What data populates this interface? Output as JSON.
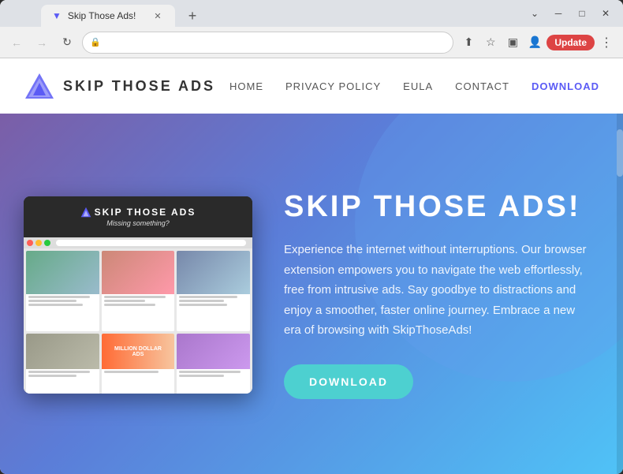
{
  "browser": {
    "tab_title": "Skip Those Ads!",
    "tab_favicon": "▼",
    "new_tab_icon": "+",
    "window_controls": {
      "chevron_down": "⌄",
      "minimize": "─",
      "maximize": "□",
      "close": "✕"
    },
    "nav": {
      "back_icon": "←",
      "forward_icon": "→",
      "refresh_icon": "↻",
      "lock_icon": "🔒",
      "address": "",
      "share_icon": "⬆",
      "star_icon": "☆",
      "tab_icon": "▣",
      "profile_icon": "👤",
      "update_label": "Update",
      "menu_icon": "⋮"
    }
  },
  "site": {
    "logo_text": "SKIP  THOSE  ADS",
    "nav_links": [
      {
        "label": "Home",
        "active": false
      },
      {
        "label": "Privacy Policy",
        "active": false
      },
      {
        "label": "EULA",
        "active": false
      },
      {
        "label": "Contact",
        "active": false
      },
      {
        "label": "DOWNLOAD",
        "active": true,
        "highlight": true
      }
    ],
    "hero": {
      "screenshot_title": "SKIP  THOSE  ADS",
      "screenshot_subtitle": "Missing something?",
      "title": "SKIP THOSE ADS!",
      "description": "Experience the internet without interruptions. Our browser extension empowers you to navigate the web effortlessly, free from intrusive ads. Say goodbye to distractions and enjoy a smoother, faster online journey. Embrace a new era of browsing with SkipThoseAds!",
      "download_button": "DOWNLOAD"
    }
  }
}
